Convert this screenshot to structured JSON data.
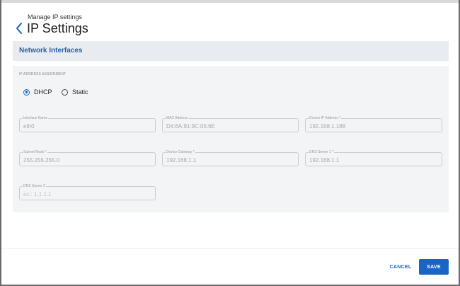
{
  "header": {
    "breadcrumb": "Manage IP settings",
    "title": "IP Settings",
    "back_icon": "chevron-left-icon"
  },
  "section": {
    "title": "Network Interfaces"
  },
  "ip_assignment": {
    "label": "IP ADDRESS ASSIGNMENT",
    "options": [
      {
        "label": "DHCP",
        "selected": true
      },
      {
        "label": "Static",
        "selected": false
      }
    ]
  },
  "fields": {
    "interface_name": {
      "label": "Interface Name",
      "value": "eth0"
    },
    "mac_address": {
      "label": "MAC Address",
      "value": "D4:6A:91:9C:05:6E"
    },
    "device_ip": {
      "label": "Device IP Address *",
      "value": "192.168.1.188"
    },
    "subnet_mask": {
      "label": "Subnet Mask *",
      "value": "255.255.255.0"
    },
    "device_gateway": {
      "label": "Device Gateway *",
      "value": "192.168.1.1"
    },
    "dns_server_1": {
      "label": "DNS Server 1 *",
      "value": "192.168.1.1"
    },
    "dns_server_2": {
      "label": "DNS Server 2",
      "value": "",
      "placeholder": "ex.: 1.1.1.1"
    }
  },
  "footer": {
    "cancel_label": "CANCEL",
    "save_label": "SAVE"
  },
  "colors": {
    "accent": "#1a64c8",
    "section_title": "#2a5fa6",
    "section_bg": "#e8ecf0",
    "panel_bg": "#f3f4f6"
  }
}
